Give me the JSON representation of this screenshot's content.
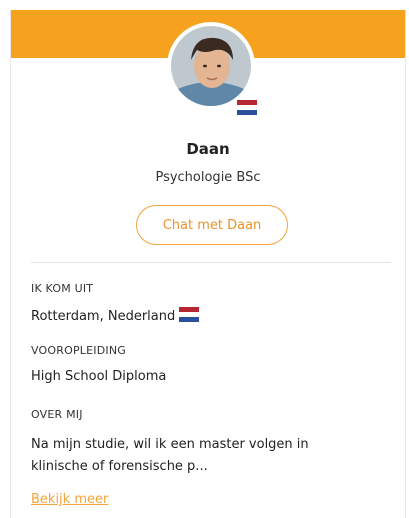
{
  "profile": {
    "name": "Daan",
    "study": "Psychologie BSc",
    "chat_button_label": "Chat met Daan",
    "flag_icon": "netherlands-flag-icon"
  },
  "sections": {
    "origin_label": "IK KOM UIT",
    "origin_value": "Rotterdam, Nederland",
    "education_label": "VOOROPLEIDING",
    "education_value": "High School Diploma",
    "about_label": "OVER MIJ",
    "about_value": "Na mijn studie, wil ik een master volgen in klinische of forensische p..."
  },
  "more_link_label": "Bekijk meer",
  "colors": {
    "accent": "#f6a21e",
    "button_text": "#e8932a",
    "link": "#f2a43a"
  }
}
